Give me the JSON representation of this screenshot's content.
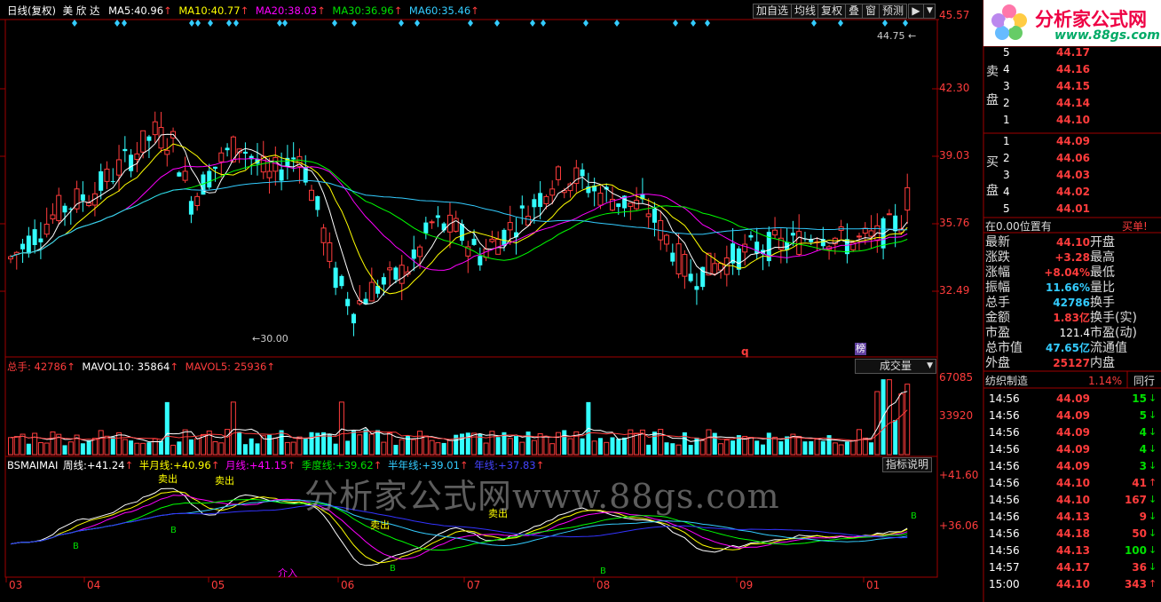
{
  "header": {
    "period": "日线(复权)",
    "stock_name": "美 欣 达",
    "ma5_label": "MA5:",
    "ma5": "40.96",
    "ma10_label": "MA10:",
    "ma10": "40.77",
    "ma20_label": "MA20:",
    "ma20": "38.03",
    "ma30_label": "MA30:",
    "ma30": "36.96",
    "ma60_label": "MA60:",
    "ma60": "35.46",
    "up_arrow": "↑"
  },
  "toolbar": {
    "add_watch": "加自选",
    "avg_line": "均线",
    "adjust": "复权",
    "overlay": "叠",
    "window": "窗",
    "predict": "预测"
  },
  "price_axis": [
    "45.57",
    "42.30",
    "39.03",
    "35.76",
    "32.49"
  ],
  "price_annotations": {
    "high": "44.75",
    "low": "30.00",
    "marker_q": "q",
    "marker_bang": "榜"
  },
  "volume": {
    "total_label": "总手:",
    "total": "42786",
    "mavol10_label": "MAVOL10:",
    "mavol10": "35864",
    "mavol5_label": "MAVOL5:",
    "mavol5": "25936",
    "dropdown": "成交量",
    "axis": [
      "67085",
      "33920"
    ]
  },
  "indicator": {
    "name": "BSMAIMAI",
    "week_label": "周线:",
    "week": "+41.24",
    "halfmonth_label": "半月线:",
    "halfmonth": "+40.96",
    "month_label": "月线:",
    "month": "+41.15",
    "quarter_label": "季度线:",
    "quarter": "+39.62",
    "halfyear_label": "半年线:",
    "halfyear": "+39.01",
    "year_label": "年线:",
    "year": "+37.83",
    "explain_button": "指标说明",
    "axis": [
      "+41.60",
      "+36.06"
    ],
    "sell_tag": "卖出",
    "buy_tag": "B",
    "enter_tag": "介入"
  },
  "x_axis": [
    "03",
    "04",
    "05",
    "06",
    "07",
    "08",
    "09",
    "01"
  ],
  "watermark": "分析家公式网www.88gs.com",
  "logo": {
    "title": "分析家公式网",
    "url": "www.88gs.com"
  },
  "order_book": {
    "sell_label_1": "卖",
    "sell_label_2": "盘",
    "buy_label_1": "买",
    "buy_label_2": "盘",
    "asks": [
      {
        "level": "5",
        "price": "44.17"
      },
      {
        "level": "4",
        "price": "44.16"
      },
      {
        "level": "3",
        "price": "44.15"
      },
      {
        "level": "2",
        "price": "44.14"
      },
      {
        "level": "1",
        "price": "44.10"
      }
    ],
    "bids": [
      {
        "level": "1",
        "price": "44.09"
      },
      {
        "level": "2",
        "price": "44.06"
      },
      {
        "level": "3",
        "price": "44.03"
      },
      {
        "level": "4",
        "price": "44.02"
      },
      {
        "level": "5",
        "price": "44.01"
      }
    ],
    "position_text": "在0.00位置有",
    "buy_order": "买单!"
  },
  "quote": {
    "left": [
      {
        "label": "最新",
        "value": "44.10"
      },
      {
        "label": "涨跌",
        "value": "+3.28"
      },
      {
        "label": "涨幅",
        "value": "+8.04%"
      },
      {
        "label": "振幅",
        "value": "11.66%"
      },
      {
        "label": "总手",
        "value": "42786"
      },
      {
        "label": "金额",
        "value": "1.83亿"
      },
      {
        "label": "市盈",
        "value": "121.4"
      },
      {
        "label": "总市值",
        "value": "47.65亿"
      },
      {
        "label": "外盘",
        "value": "25127"
      }
    ],
    "right": [
      "开盘",
      "最高",
      "最低",
      "量比",
      "换手",
      "换手(实)",
      "市盈(动)",
      "流通值",
      "内盘"
    ]
  },
  "sector": {
    "name": "纺织制造",
    "change": "1.14%",
    "tab": "同行"
  },
  "ticks": [
    {
      "time": "14:56",
      "price": "44.09",
      "vol": "15",
      "dir": "↓",
      "color": "grn"
    },
    {
      "time": "14:56",
      "price": "44.09",
      "vol": "5",
      "dir": "↓",
      "color": "grn"
    },
    {
      "time": "14:56",
      "price": "44.09",
      "vol": "4",
      "dir": "↓",
      "color": "grn"
    },
    {
      "time": "14:56",
      "price": "44.09",
      "vol": "4",
      "dir": "↓",
      "color": "grn"
    },
    {
      "time": "14:56",
      "price": "44.09",
      "vol": "3",
      "dir": "↓",
      "color": "grn"
    },
    {
      "time": "14:56",
      "price": "44.10",
      "vol": "41",
      "dir": "↑",
      "color": "red"
    },
    {
      "time": "14:56",
      "price": "44.10",
      "vol": "167",
      "dir": "↓",
      "color": "red"
    },
    {
      "time": "14:56",
      "price": "44.13",
      "vol": "9",
      "dir": "↓",
      "color": "red"
    },
    {
      "time": "14:56",
      "price": "44.18",
      "vol": "50",
      "dir": "↓",
      "color": "red"
    },
    {
      "time": "14:56",
      "price": "44.13",
      "vol": "100",
      "dir": "↓",
      "color": "grn"
    },
    {
      "time": "14:57",
      "price": "44.17",
      "vol": "36",
      "dir": "↓",
      "color": "red"
    },
    {
      "time": "15:00",
      "price": "44.10",
      "vol": "343",
      "dir": "↑",
      "color": "red"
    }
  ],
  "colors": {
    "up": "#ff3c3c",
    "down": "#3ff",
    "ma5": "#ffffff",
    "ma10": "#ffff00",
    "ma20": "#ff00ff",
    "ma30": "#00ff00",
    "ma60": "#3cf",
    "frame": "#a00000"
  }
}
